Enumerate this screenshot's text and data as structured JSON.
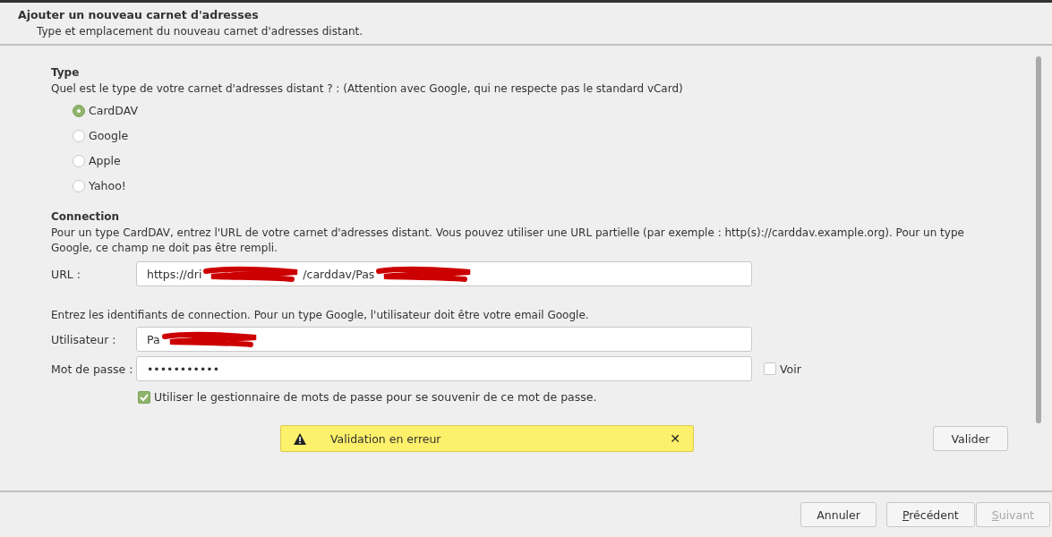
{
  "header": {
    "title": "Ajouter un nouveau carnet d'adresses",
    "subtitle": "Type et emplacement du nouveau carnet d'adresses distant."
  },
  "type_section": {
    "heading": "Type",
    "question": "Quel est le type de votre carnet d'adresses distant ? : (Attention avec Google, qui ne respecte pas le standard vCard)",
    "options": [
      {
        "label": "CardDAV",
        "selected": true
      },
      {
        "label": "Google",
        "selected": false
      },
      {
        "label": "Apple",
        "selected": false
      },
      {
        "label": "Yahoo!",
        "selected": false
      }
    ]
  },
  "connection": {
    "heading": "Connection",
    "description": "Pour un type CardDAV, entrez l'URL de votre carnet d'adresses distant. Vous pouvez utiliser une URL partielle (par exemple : http(s)://carddav.example.org). Pour un type Google, ce champ ne doit pas être rempli.",
    "url": {
      "label": "URL :",
      "value_parts": [
        "https://dri",
        "/carddav/Pas"
      ]
    },
    "credentials_hint": "Entrez les identifiants de connection. Pour un type Google, l'utilisateur doit être votre email Google.",
    "user": {
      "label": "Utilisateur :",
      "value_parts": [
        "Pa"
      ]
    },
    "password": {
      "label": "Mot de passe :",
      "value": "•••••••••••"
    },
    "show_password": {
      "label": "Voir",
      "checked": false
    },
    "use_password_manager": {
      "label": "Utiliser le gestionnaire de mots de passe pour se souvenir de ce mot de passe.",
      "checked": true
    }
  },
  "alert": {
    "message": "Validation en erreur",
    "close": "✕"
  },
  "validate_button": "Valider",
  "buttons": [
    {
      "label": "Annuler",
      "mnemonic": false,
      "disabled": false
    },
    {
      "label": "Précédent",
      "mnemonic": true,
      "disabled": false
    },
    {
      "label": "Suivant",
      "mnemonic": true,
      "disabled": true
    }
  ]
}
